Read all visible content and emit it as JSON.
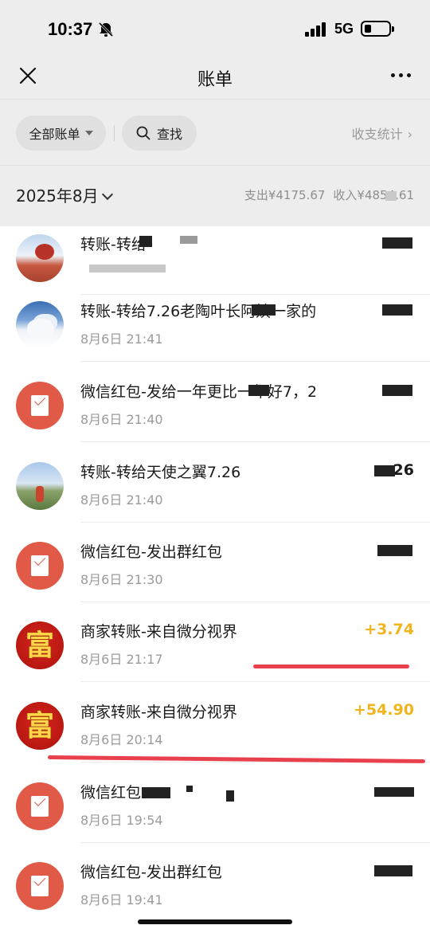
{
  "status": {
    "time": "10:37",
    "network": "5G"
  },
  "nav": {
    "title": "账单"
  },
  "filters": {
    "all_bills": "全部账单",
    "search": "查找",
    "stats": "收支统计"
  },
  "month": {
    "label": "2025年8月",
    "summary_expense": "支出¥4175.67",
    "summary_income": "收入¥4854.61"
  },
  "transactions": [
    {
      "title": "转账-转给",
      "time": "",
      "amount": "",
      "avatar": "photo-tree"
    },
    {
      "title": "转账-转给7.26老陶叶长阿姨一家的",
      "time": "8月6日 21:41",
      "amount": "",
      "avatar": "photo-snow"
    },
    {
      "title": "微信红包-发给一年更比一年好7，2",
      "time": "8月6日 21:40",
      "amount": "",
      "avatar": "red-packet-icon"
    },
    {
      "title": "转账-转给天使之翼7.26",
      "time": "8月6日 21:40",
      "amount": "26",
      "avatar": "photo-girl"
    },
    {
      "title": "微信红包-发出群红包",
      "time": "8月6日 21:30",
      "amount": "",
      "avatar": "red-packet-icon"
    },
    {
      "title": "商家转账-来自微分视界",
      "time": "8月6日 21:17",
      "amount": "+3.74",
      "avatar": "fu-icon"
    },
    {
      "title": "商家转账-来自微分视界",
      "time": "8月6日 20:14",
      "amount": "+54.90",
      "avatar": "fu-icon"
    },
    {
      "title": "微信红包",
      "time": "8月6日 19:54",
      "amount": "",
      "avatar": "red-packet-icon"
    },
    {
      "title": "微信红包-发出群红包",
      "time": "8月6日 19:41",
      "amount": "",
      "avatar": "red-packet-icon"
    }
  ],
  "fu_char": "富",
  "colors": {
    "income": "#f0b41d",
    "red_packet": "#e05a47",
    "annotation": "#e8414d",
    "header_bg": "#ededed"
  }
}
